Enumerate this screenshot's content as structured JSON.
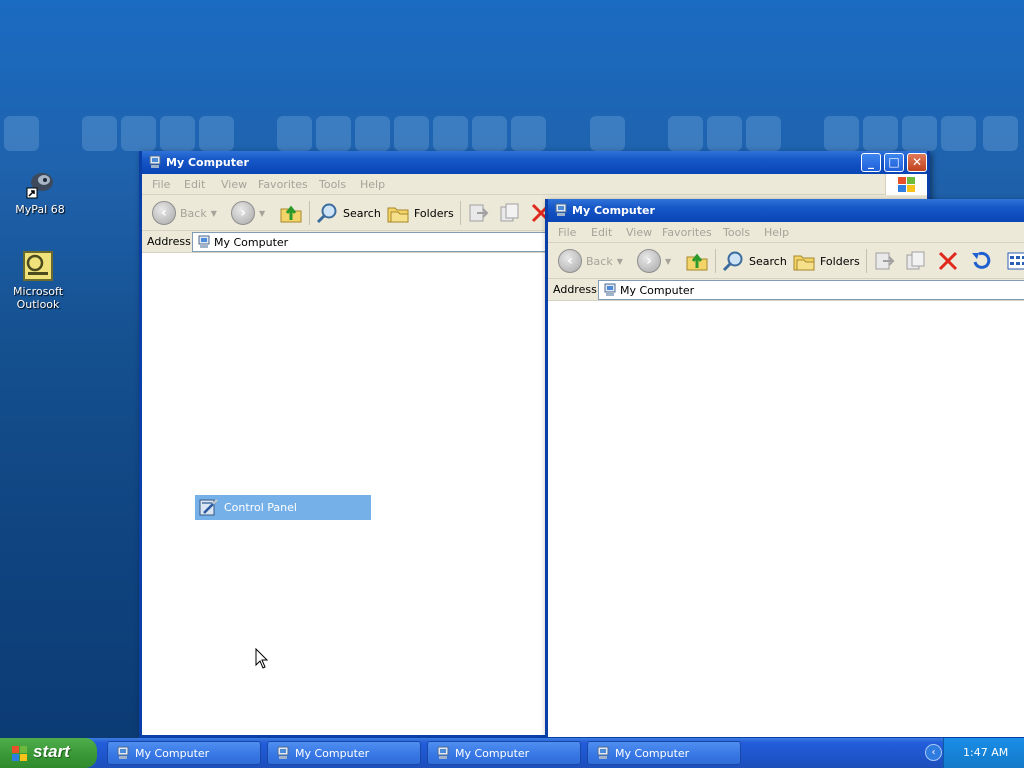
{
  "desktop": {
    "icons": [
      {
        "label": "MyPal 68",
        "icon": "mypal-shortcut-icon"
      },
      {
        "label": "Microsoft Outlook",
        "icon": "outlook-icon"
      }
    ]
  },
  "window_back": {
    "title": "My Computer",
    "menu": [
      "File",
      "Edit",
      "View",
      "Favorites",
      "Tools",
      "Help"
    ],
    "toolbar": {
      "back": "Back",
      "search": "Search",
      "folders": "Folders"
    },
    "address_label": "Address",
    "address_value": "My Computer",
    "selected_item": "Control Panel"
  },
  "window_front": {
    "title": "My Computer",
    "menu": [
      "File",
      "Edit",
      "View",
      "Favorites",
      "Tools",
      "Help"
    ],
    "toolbar": {
      "back": "Back",
      "search": "Search",
      "folders": "Folders"
    },
    "address_label": "Address",
    "address_value": "My Computer"
  },
  "taskbar": {
    "start_label": "start",
    "tasks": [
      "My Computer",
      "My Computer",
      "My Computer",
      "My Computer"
    ],
    "clock": "1:47 AM"
  },
  "colors": {
    "titlebar": "#0a45b4",
    "selection": "#75b1e8",
    "start_green": "#3c9a38"
  }
}
